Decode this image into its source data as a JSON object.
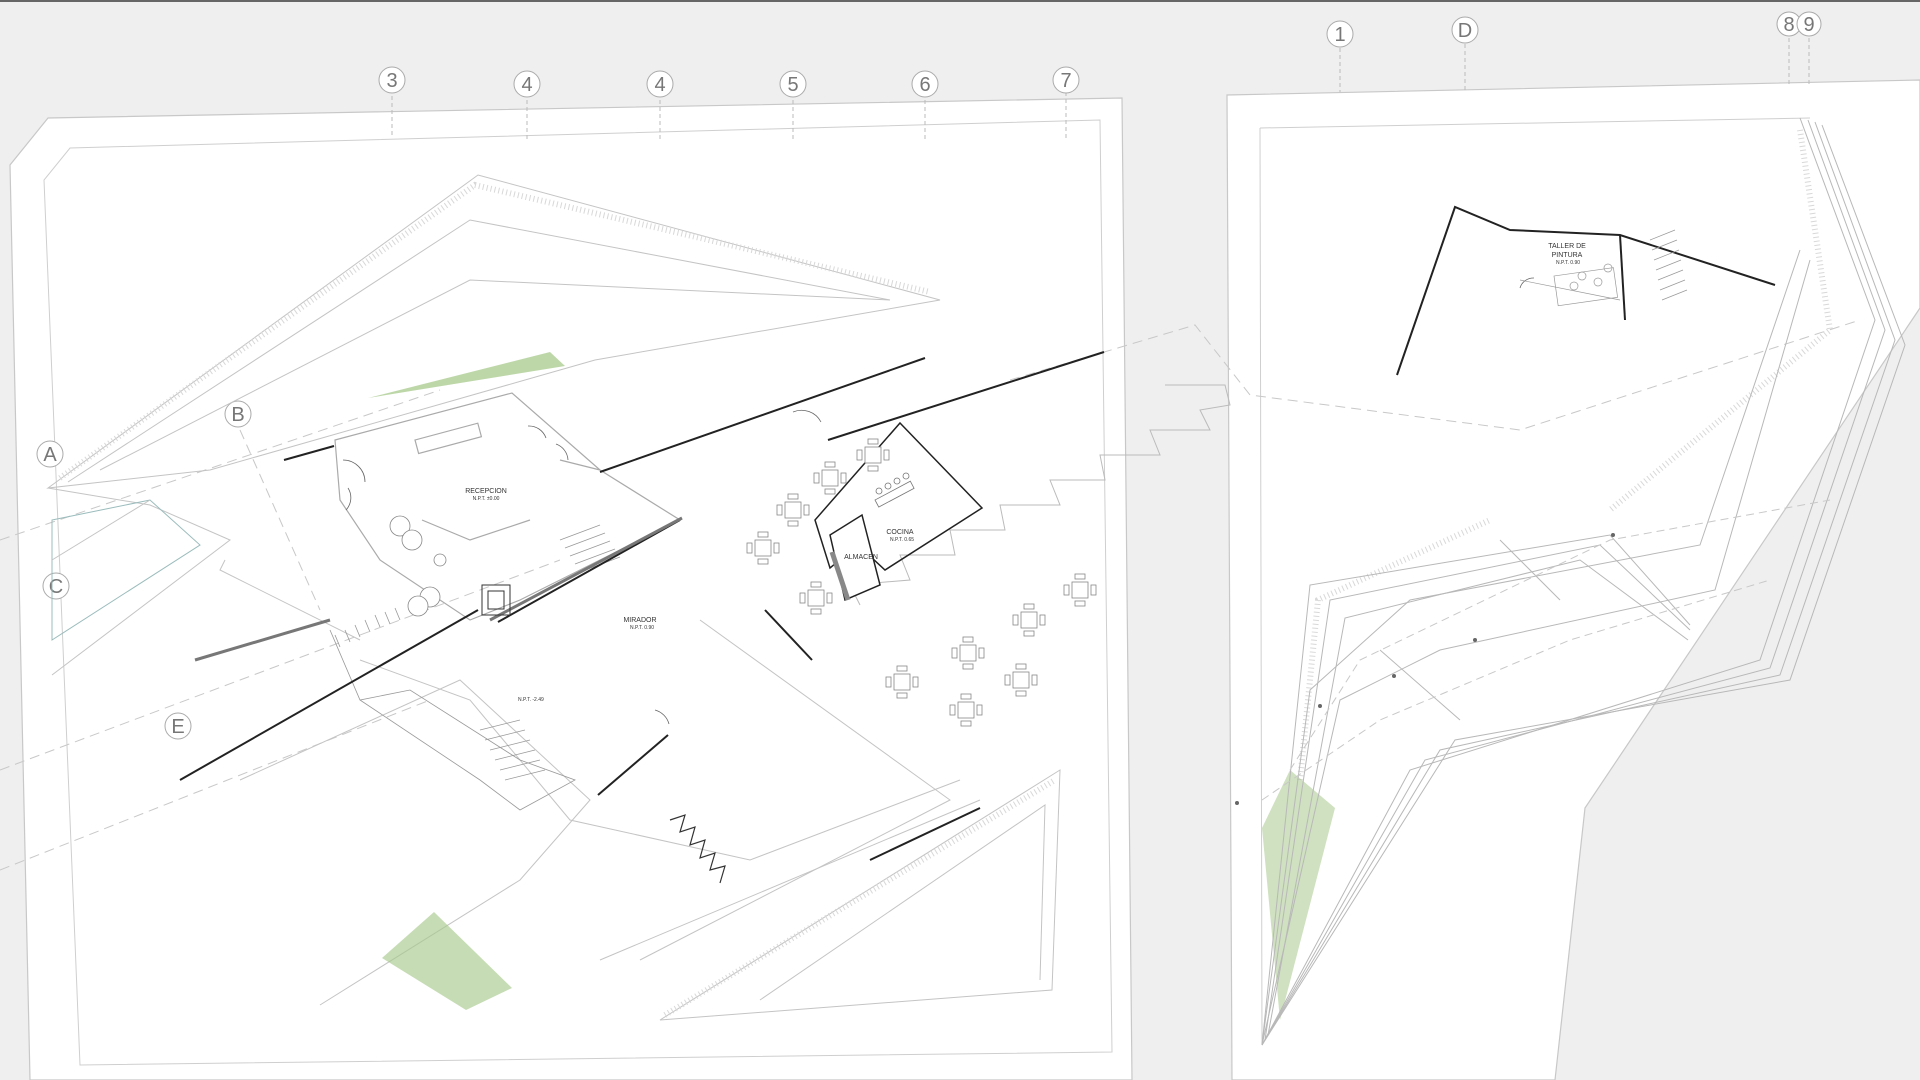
{
  "plan": {
    "background_color": "#efefef",
    "paper_color": "#ffffff",
    "line_color": "#b8b8b8",
    "wall_color": "#222222",
    "planting_color": "#a8c98c",
    "grid_axes_top": [
      "3",
      "4",
      "4",
      "5",
      "6",
      "7",
      "1",
      "D",
      "8",
      "9"
    ],
    "grid_axes_left": [
      "A",
      "B",
      "C",
      "E"
    ],
    "rooms": {
      "recepcion": {
        "name": "RECEPCION",
        "level": "N.P.T. ±0.00"
      },
      "cocina": {
        "name": "COCINA",
        "level": "N.P.T. 0.65"
      },
      "almacen": {
        "name": "ALMACEN"
      },
      "mirador": {
        "name": "MIRADOR",
        "level": "N.P.T. 0.90"
      },
      "taller": {
        "name_line1": "TALLER DE",
        "name_line2": "PINTURA",
        "level": "N.P.T. 0.90"
      }
    },
    "level_marks": [
      "N.P.T. -2.49"
    ]
  }
}
